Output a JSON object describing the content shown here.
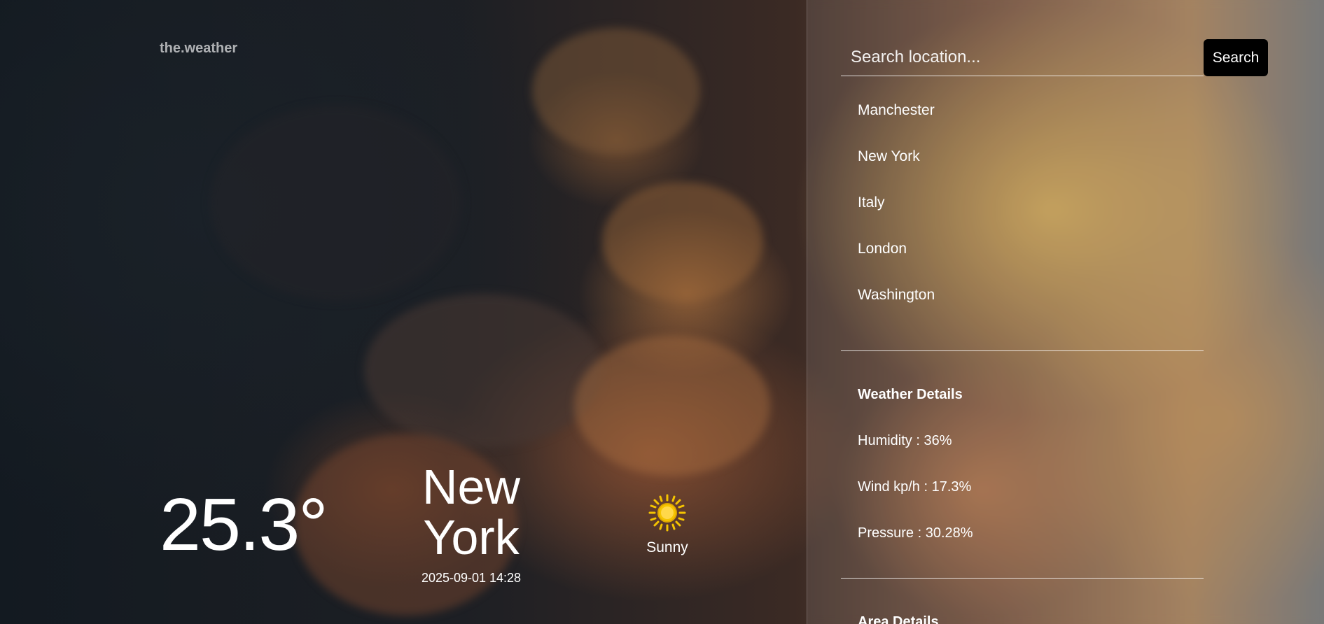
{
  "app": {
    "logo": "the.weather"
  },
  "current": {
    "temperature": "25.3°",
    "city": "New\nYork",
    "datetime": "2025-09-01 14:28",
    "condition": "Sunny",
    "condition_icon": "sun-icon"
  },
  "search": {
    "placeholder": "Search location...",
    "value": "",
    "button_label": "Search"
  },
  "locations": [
    {
      "label": "Manchester"
    },
    {
      "label": "New York"
    },
    {
      "label": "Italy"
    },
    {
      "label": "London"
    },
    {
      "label": "Washington"
    }
  ],
  "weather_details": {
    "title": "Weather Details",
    "items": [
      {
        "label": "Humidity : 36%"
      },
      {
        "label": "Wind kp/h : 17.3%"
      },
      {
        "label": "Pressure : 30.28%"
      }
    ]
  },
  "area_details": {
    "title": "Area Details"
  },
  "colors": {
    "button_bg": "#000000",
    "text": "#ffffff",
    "sun": "#f5c400"
  }
}
